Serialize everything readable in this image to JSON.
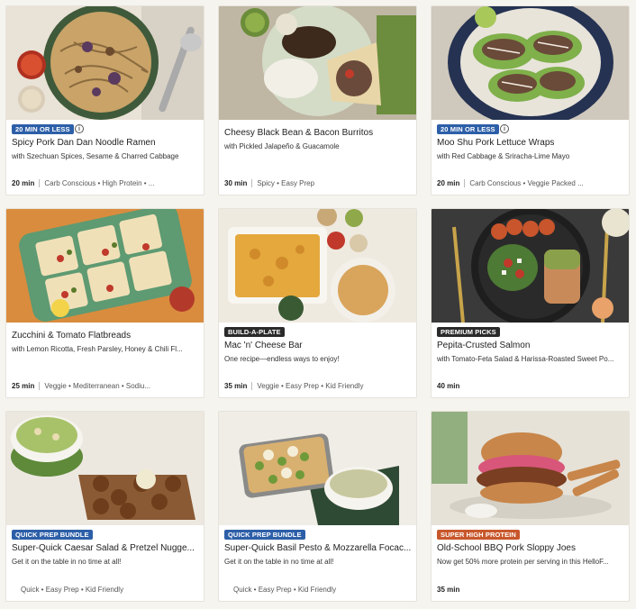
{
  "colors": {
    "badge_blue": "#2d5fa8",
    "badge_dark": "#2a2a2a",
    "badge_orange": "#c8572b",
    "card_bg": "#ffffff",
    "page_bg": "#f6f4ef"
  },
  "recipes": [
    {
      "badge": "20 MIN OR LESS",
      "badge_color": "#2d5fa8",
      "has_info_icon": true,
      "title": "Spicy Pork Dan Dan Noodle Ramen",
      "subtitle": "with Szechuan Spices, Sesame & Charred Cabbage",
      "time": "20 min",
      "tags": "Carb Conscious • High Protein • ..."
    },
    {
      "badge": "",
      "title": "Cheesy Black Bean & Bacon Burritos",
      "subtitle": "with Pickled Jalapeño & Guacamole",
      "time": "30 min",
      "tags": "Spicy • Easy Prep"
    },
    {
      "badge": "20 MIN OR LESS",
      "badge_color": "#2d5fa8",
      "has_info_icon": true,
      "title": "Moo Shu Pork Lettuce Wraps",
      "subtitle": "with Red Cabbage & Sriracha-Lime Mayo",
      "time": "20 min",
      "tags": "Carb Conscious • Veggie Packed ..."
    },
    {
      "badge": "",
      "title": "Zucchini & Tomato Flatbreads",
      "subtitle": "with Lemon Ricotta, Fresh Parsley, Honey & Chili Fl...",
      "time": "25 min",
      "tags": "Veggie • Mediterranean • Sodiu..."
    },
    {
      "badge": "BUILD-A-PLATE",
      "badge_color": "#2a2a2a",
      "title": "Mac 'n' Cheese Bar",
      "subtitle": "One recipe—endless ways to enjoy!",
      "time": "35 min",
      "tags": "Veggie • Easy Prep • Kid Friendly"
    },
    {
      "badge": "PREMIUM PICKS",
      "badge_color": "#2a2a2a",
      "title": "Pepita-Crusted Salmon",
      "subtitle": "with Tomato-Feta Salad & Harissa-Roasted Sweet Po...",
      "time": "40 min",
      "tags": ""
    },
    {
      "badge": "QUICK PREP BUNDLE",
      "badge_color": "#2d5fa8",
      "title": "Super-Quick Caesar Salad & Pretzel Nugge...",
      "subtitle": "Get it on the table in no time at all!",
      "time": "",
      "tags": "Quick • Easy Prep • Kid Friendly"
    },
    {
      "badge": "QUICK PREP BUNDLE",
      "badge_color": "#2d5fa8",
      "title": "Super-Quick Basil Pesto & Mozzarella Focac...",
      "subtitle": "Get it on the table in no time at all!",
      "time": "",
      "tags": "Quick • Easy Prep • Kid Friendly"
    },
    {
      "badge": "SUPER HIGH PROTEIN",
      "badge_color": "#c8572b",
      "title": "Old-School BBQ Pork Sloppy Joes",
      "subtitle": "Now get 50% more protein per serving in this HelloF...",
      "time": "35 min",
      "tags": ""
    }
  ]
}
